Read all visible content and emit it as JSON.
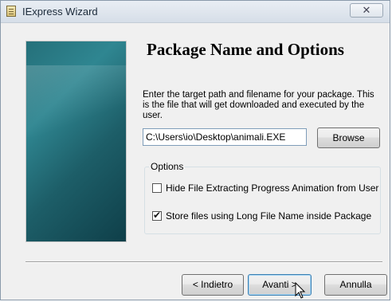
{
  "window": {
    "title": "IExpress Wizard",
    "close_symbol": "✕"
  },
  "page": {
    "heading": "Package Name and Options",
    "description": "Enter the target path and filename for your package. This is the file that will get downloaded and executed by the user.",
    "path_value": "C:\\Users\\io\\Desktop\\animali.EXE",
    "browse_label": "Browse"
  },
  "options": {
    "group_label": "Options",
    "items": [
      {
        "label": "Hide File Extracting Progress Animation from User",
        "checked": false
      },
      {
        "label": "Store files using Long File Name inside Package",
        "checked": true
      }
    ]
  },
  "footer": {
    "back_label": "< Indietro",
    "next_label": "Avanti >",
    "cancel_label": "Annulla"
  },
  "icons": [
    "app-icon",
    "close-icon",
    "mouse-pointer-icon"
  ],
  "colors": {
    "side_panel": "#2f8691",
    "accent_button_border": "#3c7fb1"
  }
}
